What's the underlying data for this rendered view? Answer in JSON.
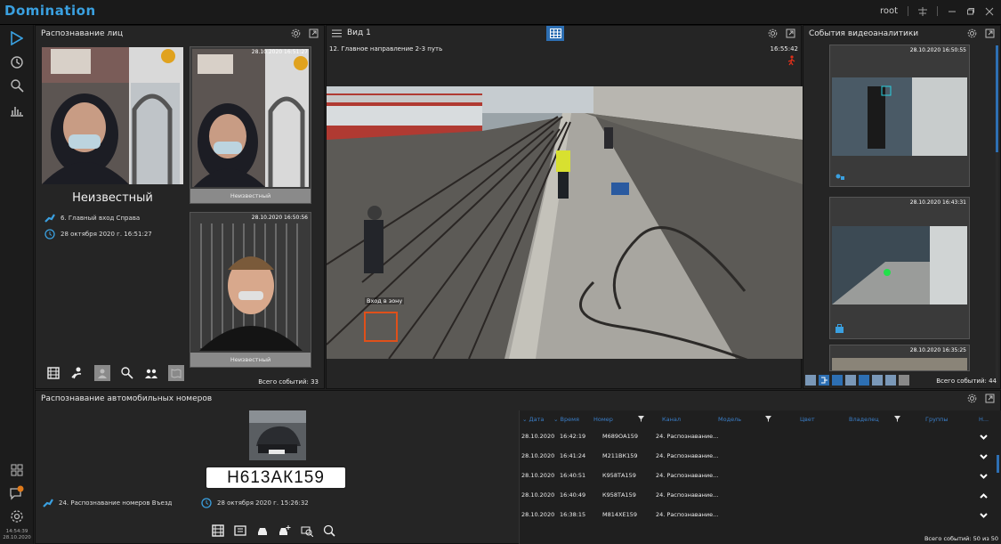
{
  "app": {
    "title": "Domination",
    "user": "root"
  },
  "status": {
    "time": "14:54:39",
    "date": "28.10.2020"
  },
  "faces": {
    "title": "Распознавание лиц",
    "main_name": "Неизвестный",
    "main_channel": "6. Главный вход Справа",
    "main_datetime": "28 октября 2020 г. 16:51:27",
    "cards": [
      {
        "time": "28.10.2020 16:51:27",
        "label": "Неизвестный"
      },
      {
        "time": "28.10.2020 16:50:56",
        "label": "Неизвестный"
      }
    ],
    "total": "Всего событий: 33"
  },
  "view": {
    "title": "Вид 1",
    "camera": "12. Главное направление 2-3 путь",
    "clock": "16:55:42",
    "zone_label": "Вход в зону"
  },
  "events": {
    "title": "События видеоаналитики",
    "cards": [
      {
        "time": "28.10.2020 16:50:55"
      },
      {
        "time": "28.10.2020 16:43:31"
      },
      {
        "time": "28.10.2020 16:35:25"
      }
    ],
    "total": "Всего событий: 44"
  },
  "plates": {
    "title": "Распознавание автомобильных номеров",
    "plate": "Н613АК159",
    "channel": "24. Распознавание номеров Въезд",
    "datetime": "28 октября 2020 г. 15:26:32",
    "headers": [
      "Дата",
      "Время",
      "Номер",
      "Канал",
      "Модель",
      "Цвет",
      "Владелец",
      "Группы",
      "Н..."
    ],
    "rows": [
      {
        "date": "28.10.2020",
        "time": "16:42:19",
        "number": "М689ОА159",
        "channel": "24. Распознавание..."
      },
      {
        "date": "28.10.2020",
        "time": "16:41:24",
        "number": "М211ВК159",
        "channel": "24. Распознавание..."
      },
      {
        "date": "28.10.2020",
        "time": "16:40:51",
        "number": "К958ТА159",
        "channel": "24. Распознавание..."
      },
      {
        "date": "28.10.2020",
        "time": "16:40:49",
        "number": "К958ТА159",
        "channel": "24. Распознавание..."
      },
      {
        "date": "28.10.2020",
        "time": "16:38:15",
        "number": "М814ХЕ159",
        "channel": "24. Распознавание..."
      }
    ],
    "total": "Всего событий: 50 из 50"
  },
  "colors": {
    "accent": "#3aa0e0",
    "header_blue": "#3a7ec8",
    "zone": "#e0501a"
  }
}
